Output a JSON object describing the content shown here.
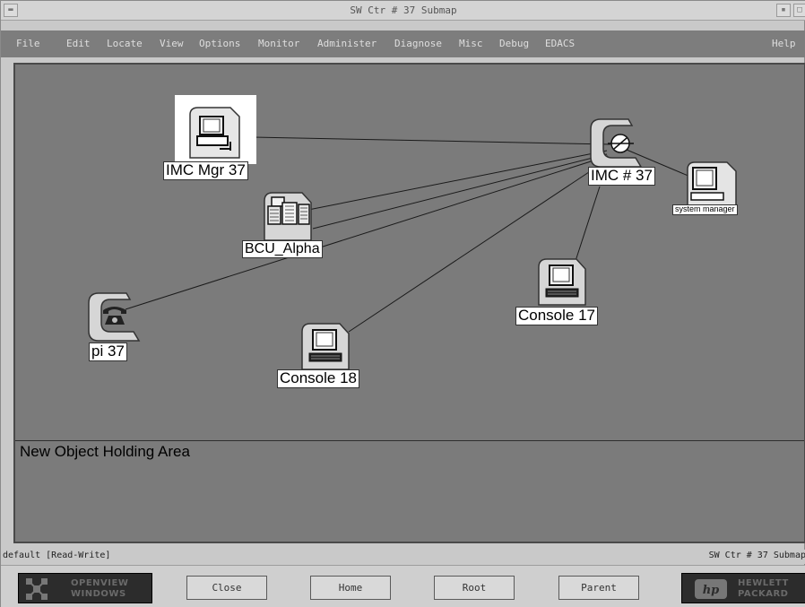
{
  "window": {
    "title": "SW Ctr # 37 Submap"
  },
  "menu": {
    "items": [
      "File",
      "Edit",
      "Locate",
      "View",
      "Options",
      "Monitor",
      "Administer",
      "Diagnose",
      "Misc",
      "Debug",
      "EDACS"
    ],
    "help": "Help"
  },
  "map": {
    "nodes": {
      "imc_mgr": {
        "label": "IMC Mgr 37",
        "icon": "workstation-icon"
      },
      "imc": {
        "label": "IMC # 37",
        "icon": "network-hub-icon"
      },
      "system_manager": {
        "label": "system manager",
        "icon": "computer-icon"
      },
      "bcu_alpha": {
        "label": "BCU_Alpha",
        "icon": "server-icon"
      },
      "pi": {
        "label": "pi 37",
        "icon": "telephone-icon"
      },
      "console_17": {
        "label": "Console 17",
        "icon": "console-icon"
      },
      "console_18": {
        "label": "Console 18",
        "icon": "console-icon"
      }
    },
    "holding_area_label": "New Object Holding Area"
  },
  "status": {
    "left": "default [Read-Write]",
    "right": "SW Ctr # 37 Submap"
  },
  "buttons": {
    "close": "Close",
    "home": "Home",
    "root": "Root",
    "parent": "Parent"
  },
  "logos": {
    "openview": [
      "OPENVIEW",
      "WINDOWS"
    ],
    "hp": [
      "HEWLETT",
      "PACKARD"
    ]
  },
  "colors": {
    "map_background": "#7b7b7b",
    "menubar": "#7d7d7d",
    "selection": "#ffffff"
  }
}
